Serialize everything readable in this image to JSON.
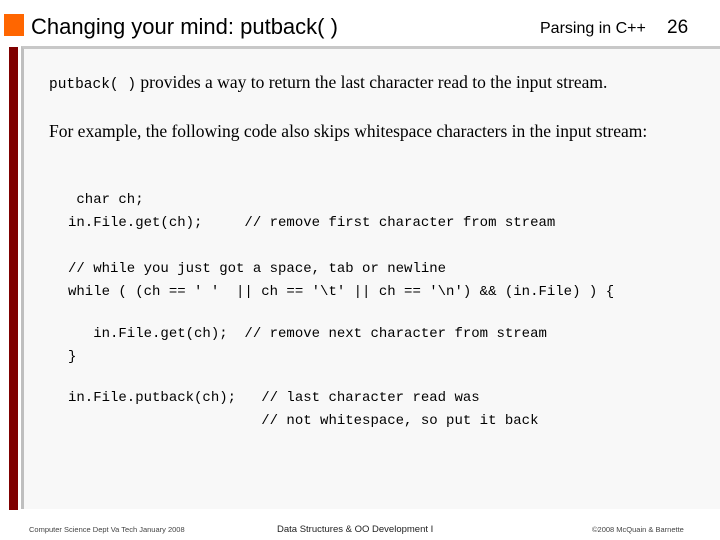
{
  "header": {
    "title": "Changing your mind:  putback( )",
    "topic": "Parsing in C++",
    "page_number": "26"
  },
  "body": {
    "intro_code": "putback( )",
    "intro_text": " provides a way to return the last character read to the input stream.",
    "example_text": "For example, the following code also skips whitespace characters in the input stream:",
    "code_lines": [
      " char ch;",
      "in.File.get(ch);     // remove first character from stream",
      "",
      "// while you just got a space, tab or newline",
      "while ( (ch == ' '  || ch == '\\t' || ch == '\\n') && (in.File) ) {",
      "",
      "   in.File.get(ch);  // remove next character from stream",
      "}",
      "",
      "in.File.putback(ch);   // last character read was",
      "                       // not whitespace, so put it back"
    ]
  },
  "footer": {
    "left": "Computer Science Dept Va Tech January 2008",
    "center": "Data Structures & OO Development I",
    "right": "©2008  McQuain & Barnette"
  },
  "colors": {
    "accent_orange": "#ff6600",
    "accent_maroon": "#7f0000"
  }
}
